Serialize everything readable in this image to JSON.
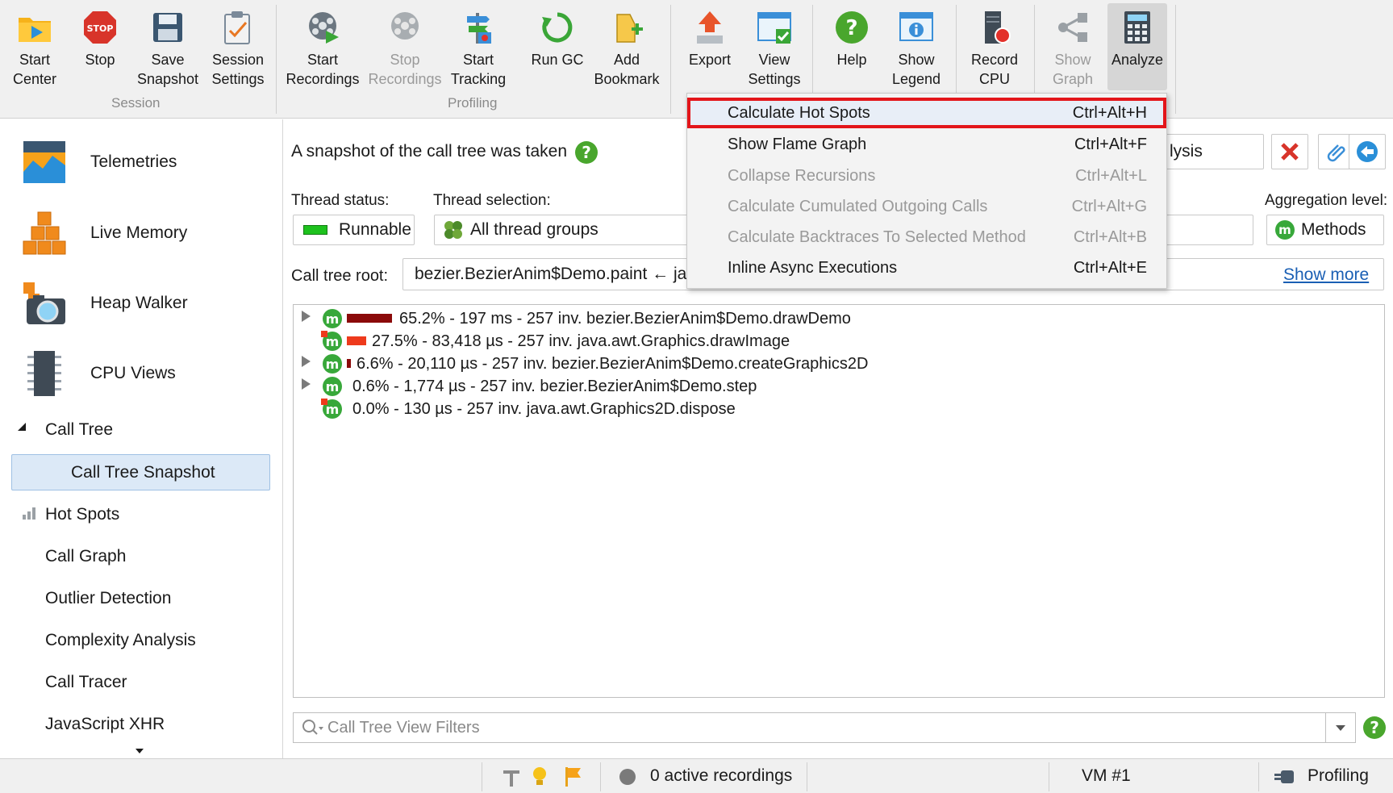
{
  "toolbar": {
    "groups": [
      {
        "label": "Session"
      },
      {
        "label": "Profiling"
      }
    ],
    "buttons": [
      {
        "label": "Start\nCenter",
        "icon": "folder-play-icon"
      },
      {
        "label": "Stop",
        "icon": "stop-sign-icon"
      },
      {
        "label": "Save\nSnapshot",
        "icon": "floppy-disk-icon"
      },
      {
        "label": "Session\nSettings",
        "icon": "clipboard-pencil-icon"
      },
      {
        "label": "Start\nRecordings",
        "icon": "film-reel-play-icon"
      },
      {
        "label": "Stop\nRecordings",
        "icon": "film-reel-stop-icon"
      },
      {
        "label": "Start\nTracking",
        "icon": "signpost-record-icon"
      },
      {
        "label": "Run GC",
        "icon": "recycle-icon"
      },
      {
        "label": "Add\nBookmark",
        "icon": "bookmark-add-icon"
      },
      {
        "label": "Export",
        "icon": "export-arrow-icon"
      },
      {
        "label": "View\nSettings",
        "icon": "window-check-icon"
      },
      {
        "label": "Help",
        "icon": "help-icon"
      },
      {
        "label": "Show\nLegend",
        "icon": "info-window-icon"
      },
      {
        "label": "Record\nCPU",
        "icon": "cpu-record-icon"
      },
      {
        "label": "Show\nGraph",
        "icon": "graph-nodes-icon"
      },
      {
        "label": "Analyze",
        "icon": "calculator-icon"
      }
    ]
  },
  "menu": {
    "items": [
      {
        "label": "Calculate Hot Spots",
        "shortcut": "Ctrl+Alt+H"
      },
      {
        "label": "Show Flame Graph",
        "shortcut": "Ctrl+Alt+F"
      },
      {
        "label": "Collapse Recursions",
        "shortcut": "Ctrl+Alt+L"
      },
      {
        "label": "Calculate Cumulated Outgoing Calls",
        "shortcut": "Ctrl+Alt+G"
      },
      {
        "label": "Calculate Backtraces To Selected Method",
        "shortcut": "Ctrl+Alt+B"
      },
      {
        "label": "Inline Async Executions",
        "shortcut": "Ctrl+Alt+E"
      }
    ]
  },
  "sidebar": {
    "big": [
      {
        "label": "Telemetries",
        "icon": "telemetries-icon"
      },
      {
        "label": "Live Memory",
        "icon": "live-memory-icon"
      },
      {
        "label": "Heap Walker",
        "icon": "heap-walker-icon"
      },
      {
        "label": "CPU Views",
        "icon": "cpu-views-icon"
      }
    ],
    "call_tree": "Call Tree",
    "call_tree_snapshot": "Call Tree Snapshot",
    "items": [
      "Hot Spots",
      "Call Graph",
      "Outlier Detection",
      "Complexity Analysis",
      "Call Tracer",
      "JavaScript XHR"
    ]
  },
  "main": {
    "info": "A snapshot of the call tree was taken",
    "analysis_partial": "lysis",
    "thread_status_label": "Thread status:",
    "thread_status_value": "Runnable",
    "thread_selection_label": "Thread selection:",
    "thread_selection_value": "All thread groups",
    "aggregation_label": "Aggregation level:",
    "aggregation_value": "Methods",
    "root_label": "Call tree root:",
    "root_value": "bezier.BezierAnim$Demo.paint ← jav",
    "show_more": "Show more",
    "filter_placeholder": "Call Tree View Filters",
    "rows": [
      {
        "text": "65.2% - 197 ms - 257 inv. bezier.BezierAnim$Demo.drawDemo",
        "percent": 65.2,
        "bar_color": "#8b0a0a",
        "expandable": true,
        "indent": 0
      },
      {
        "text": "27.5% - 83,418 µs - 257 inv. java.awt.Graphics.drawImage",
        "percent": 27.5,
        "bar_color": "#ee3a1c",
        "expandable": false,
        "indent": 0
      },
      {
        "text": "6.6% - 20,110 µs - 257 inv. bezier.BezierAnim$Demo.createGraphics2D",
        "percent": 6.6,
        "bar_color": "#8b0a0a",
        "expandable": true,
        "indent": 0
      },
      {
        "text": "0.6% - 1,774 µs - 257 inv. bezier.BezierAnim$Demo.step",
        "percent": 0.6,
        "bar_color": "#8b0a0a",
        "expandable": true,
        "indent": 0
      },
      {
        "text": "0.0% - 130 µs - 257 inv. java.awt.Graphics2D.dispose",
        "percent": 0.0,
        "bar_color": "#8b0a0a",
        "expandable": false,
        "indent": 0
      }
    ]
  },
  "statusbar": {
    "recordings": "0 active recordings",
    "vm": "VM #1",
    "mode": "Profiling"
  },
  "colors": {
    "accent_red": "#e3151a",
    "selection_blue": "#dce9f7",
    "method_green": "#38a83a"
  }
}
